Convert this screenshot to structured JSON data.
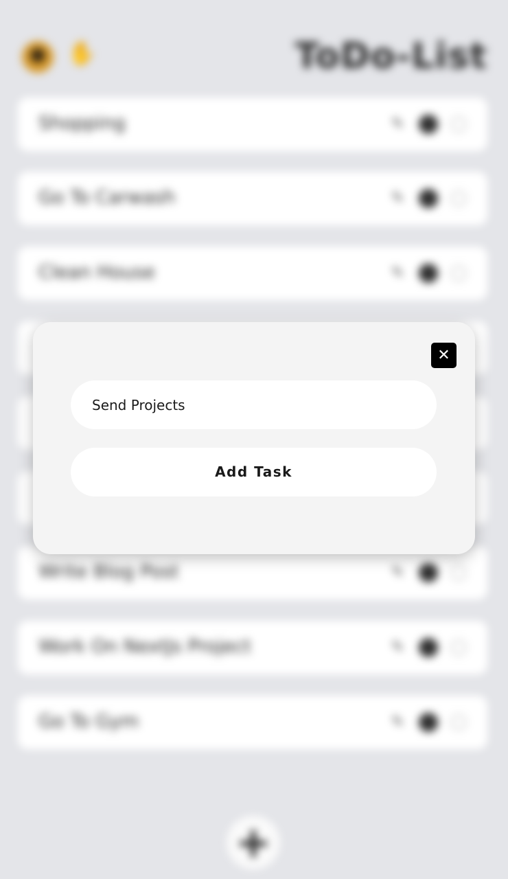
{
  "header": {
    "title": "ToDo-List",
    "avatar_icon": "avatar-icon",
    "greeting_icon": "waving-hand-icon",
    "greeting_glyph": "✋"
  },
  "tasks": [
    {
      "label": "Shopping"
    },
    {
      "label": "Go To Carwash"
    },
    {
      "label": "Clean House"
    },
    {
      "label": ""
    },
    {
      "label": ""
    },
    {
      "label": ""
    },
    {
      "label": "Write Blog Post"
    },
    {
      "label": "Work On NextJs Project"
    },
    {
      "label": "Go To Gym"
    }
  ],
  "task_icons": {
    "edit": "✎",
    "edit_icon": "edit-icon",
    "toggle_icon": "filled-dot-icon",
    "complete_icon": "empty-circle-icon"
  },
  "fab": {
    "icon": "plus-icon",
    "glyph": "+"
  },
  "modal": {
    "close_glyph": "✕",
    "close_icon": "close-icon",
    "input_value": "Send Projects",
    "add_label": "Add Task"
  },
  "colors": {
    "background": "#e4e5e9",
    "modal_bg": "#f4f4f4",
    "card_bg": "#ffffff",
    "close_bg": "#000000"
  }
}
